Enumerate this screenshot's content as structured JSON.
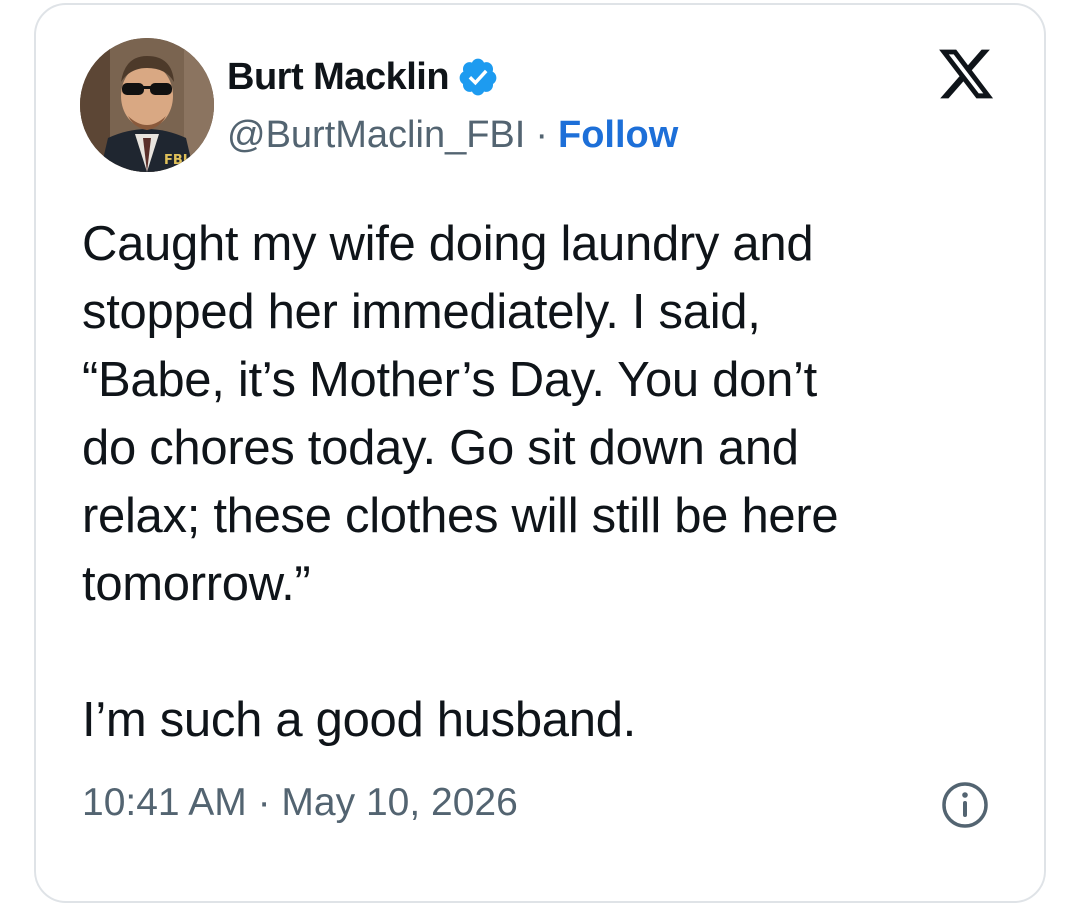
{
  "author": {
    "display_name": "Burt Macklin",
    "handle": "@BurtMaclin_FBI",
    "separator": "·",
    "follow_label": "Follow",
    "avatar_badge_text": "FBI",
    "verified_icon": "verified-badge-icon"
  },
  "brand": {
    "logo": "x-logo-icon"
  },
  "tweet": {
    "body": "Caught my wife doing laundry and\nstopped her immediately. I said,\n“Babe, it’s Mother’s Day. You don’t\ndo chores today. Go sit down and\nrelax; these clothes will still be here\ntomorrow.”",
    "closing_line": "I’m such a good husband.",
    "timestamp": "10:41 AM · May 10, 2026"
  },
  "icons": {
    "info": "info-icon"
  },
  "colors": {
    "verified_blue": "#1d9bf0",
    "follow_blue": "#1d6fd8",
    "text_primary": "#0f1419",
    "text_secondary": "#536471",
    "card_border": "#dfe3e7"
  }
}
